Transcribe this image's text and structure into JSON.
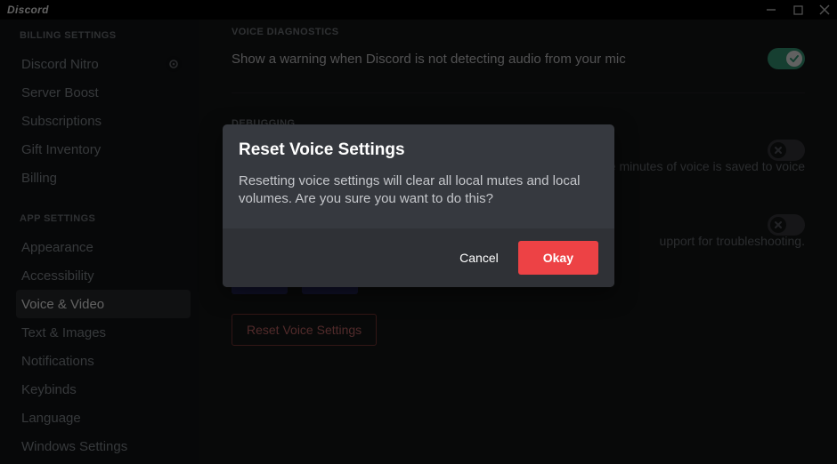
{
  "titlebar": {
    "brand": "Discord"
  },
  "sidebar": {
    "header_billing": "BILLING SETTINGS",
    "header_app": "APP SETTINGS",
    "items_billing": [
      {
        "label": "Discord Nitro",
        "icon": "nitro"
      },
      {
        "label": "Server Boost"
      },
      {
        "label": "Subscriptions"
      },
      {
        "label": "Gift Inventory"
      },
      {
        "label": "Billing"
      }
    ],
    "items_app": [
      {
        "label": "Appearance"
      },
      {
        "label": "Accessibility"
      },
      {
        "label": "Voice & Video",
        "selected": true
      },
      {
        "label": "Text & Images"
      },
      {
        "label": "Notifications"
      },
      {
        "label": "Keybinds"
      },
      {
        "label": "Language"
      },
      {
        "label": "Windows Settings"
      }
    ]
  },
  "content": {
    "voice_diag_header": "VOICE DIAGNOSTICS",
    "voice_diag_text": "Show a warning when Discord is not detecting audio from your mic",
    "debug_header": "DEBUGGING",
    "debug_text_tail": "five minutes of voice is saved to voice",
    "debug_sub_tail": "upport for troubleshooting.",
    "reset_button": "Reset Voice Settings"
  },
  "modal": {
    "title": "Reset Voice Settings",
    "text": "Resetting voice settings will clear all local mutes and local volumes. Are you sure you want to do this?",
    "cancel": "Cancel",
    "okay": "Okay"
  }
}
